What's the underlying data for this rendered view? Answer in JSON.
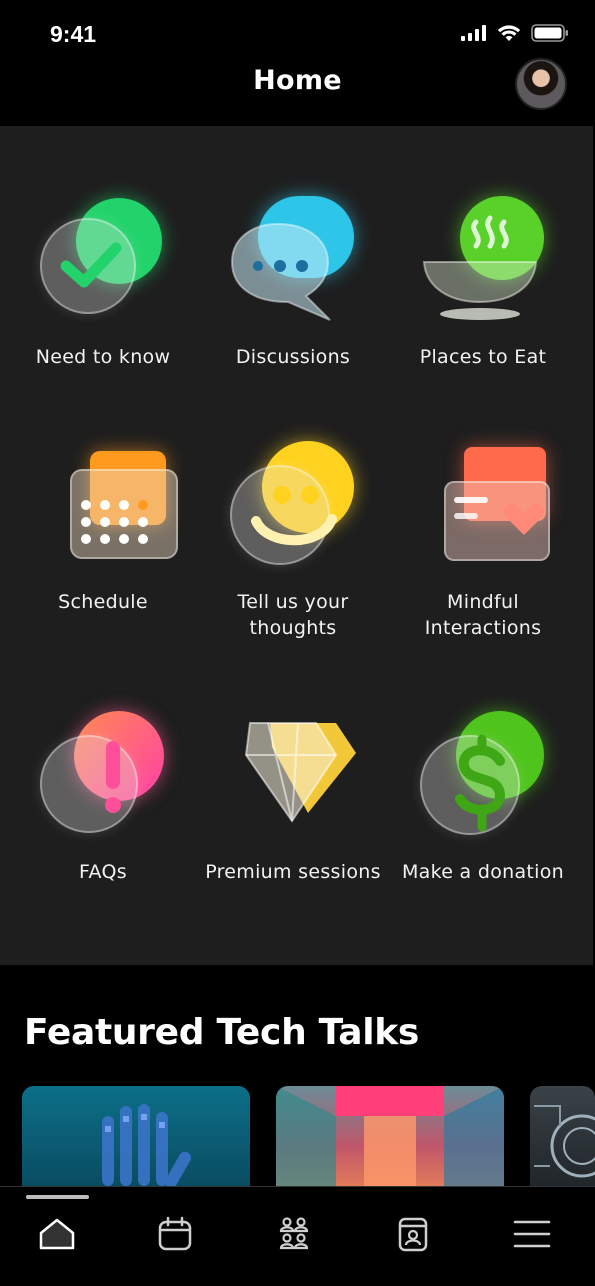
{
  "status_bar": {
    "time": "9:41"
  },
  "header": {
    "title": "Home"
  },
  "tiles": [
    {
      "label": "Need to know",
      "icon": "check-icon",
      "color": "#22d36b"
    },
    {
      "label": "Discussions",
      "icon": "chat-bubbles-icon",
      "color": "#2ec6e8"
    },
    {
      "label": "Places to Eat",
      "icon": "soup-bowl-icon",
      "color": "#5ad12a"
    },
    {
      "label": "Schedule",
      "icon": "calendar-icon",
      "color": "#ff9a1f"
    },
    {
      "label": "Tell us your thoughts",
      "icon": "smiley-icon",
      "color": "#ffd21f"
    },
    {
      "label": "Mindful Interactions",
      "icon": "heart-card-icon",
      "color": "#ff6a4a"
    },
    {
      "label": "FAQs",
      "icon": "exclamation-icon",
      "color": "#ff5fa0"
    },
    {
      "label": "Premium sessions",
      "icon": "diamond-icon",
      "color": "#ffd23a"
    },
    {
      "label": "Make a donation",
      "icon": "dollar-icon",
      "color": "#4fc41c"
    }
  ],
  "featured": {
    "title": "Featured Tech Talks",
    "cards": [
      {
        "icon": "robot-hand-image"
      },
      {
        "icon": "neon-corridor-image"
      },
      {
        "icon": "tech-circuit-image"
      }
    ]
  },
  "nav": {
    "items": [
      {
        "icon": "home-icon",
        "selected": true
      },
      {
        "icon": "calendar-icon"
      },
      {
        "icon": "people-icon"
      },
      {
        "icon": "badge-icon"
      },
      {
        "icon": "menu-icon"
      }
    ]
  }
}
